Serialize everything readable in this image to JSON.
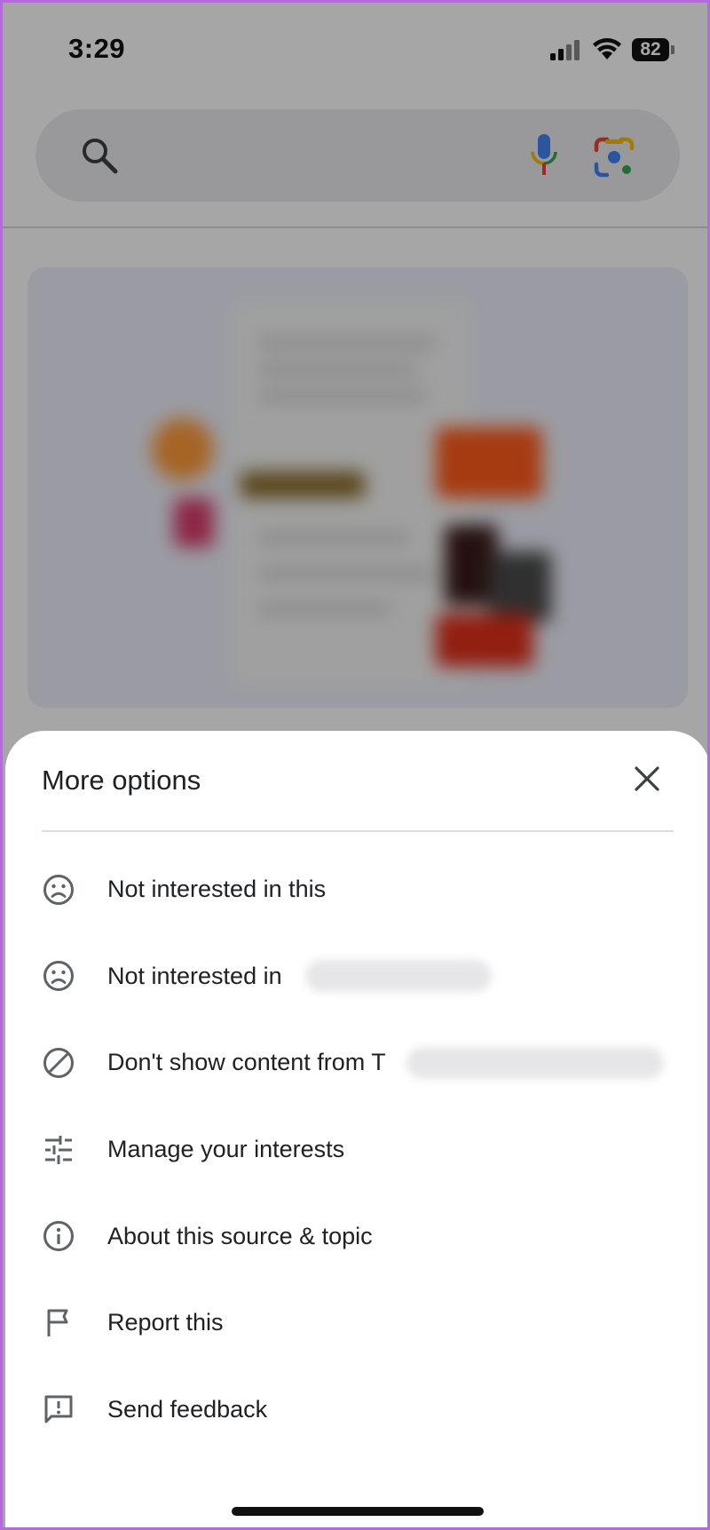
{
  "status_bar": {
    "time": "3:29",
    "battery": "82"
  },
  "sheet": {
    "title": "More options",
    "items": [
      {
        "label": "Not interested in this",
        "icon": "sad-face-icon"
      },
      {
        "label": "Not interested in",
        "icon": "sad-face-icon"
      },
      {
        "label": "Don't show content from T",
        "icon": "block-icon"
      },
      {
        "label": "Manage your interests",
        "icon": "tune-icon"
      },
      {
        "label": "About this source & topic",
        "icon": "info-icon"
      },
      {
        "label": "Report this",
        "icon": "flag-icon"
      },
      {
        "label": "Send feedback",
        "icon": "feedback-icon"
      }
    ]
  },
  "colors": {
    "text": "#202124",
    "icon": "#5f6368",
    "divider": "#dadce0",
    "frame": "#b36bdc"
  }
}
